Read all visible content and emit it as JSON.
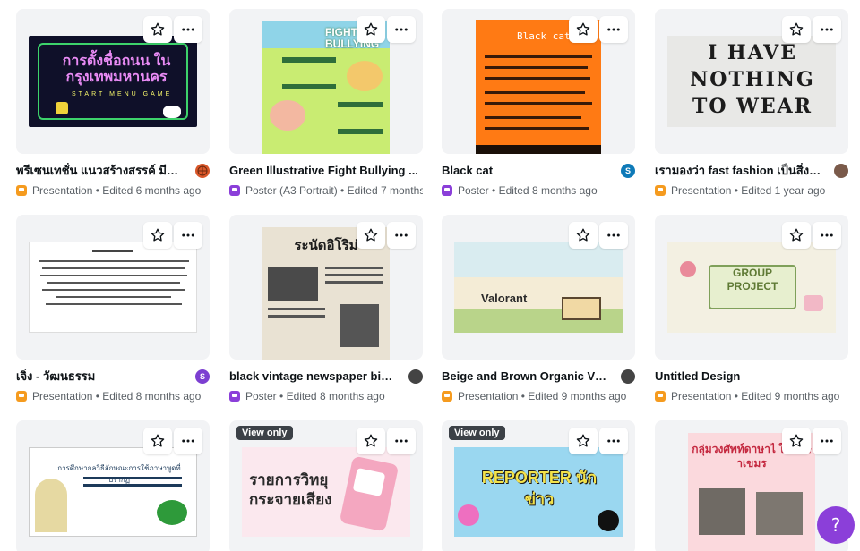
{
  "designs": [
    {
      "title": "พรีเซนเทชั่น แนวสร้างสรรค์ มีภาพ...",
      "type": "Presentation",
      "edited": "Edited 6 months ago",
      "owner": "avatar-basketball",
      "owner_color": "#d9572a",
      "thumb_text": "การตั้งชื่อถนน ในกรุงเทพมหานคร",
      "thumb_sub": "START MENU GAME"
    },
    {
      "title": "Green Illustrative Fight Bullying ...",
      "type": "Poster (A3 Portrait)",
      "edited": "Edited 7 months ago",
      "thumb_text": "FIGHT BULLYING"
    },
    {
      "title": "Black cat",
      "type": "Poster",
      "edited": "Edited 8 months ago",
      "owner_letter": "S",
      "owner_color": "#0e7ab8",
      "thumb_text": "Black cat"
    },
    {
      "title": "เรามองว่า fast fashion เป็นสิ่งที่อ...",
      "type": "Presentation",
      "edited": "Edited 1 year ago",
      "owner": "avatar-photo",
      "owner_color": "#7a5a4a",
      "thumb_text": "I HAVE NOTHING TO WEAR"
    },
    {
      "title": "เจิ่ง - วัฒนธรรม",
      "type": "Presentation",
      "edited": "Edited 8 months ago",
      "owner_letter": "S",
      "owner_color": "#7c3fd1"
    },
    {
      "title": "black vintage newspaper birt...",
      "type": "Poster",
      "edited": "Edited 8 months ago",
      "owner": "avatar-cartoon",
      "owner_color": "#444444",
      "thumb_text": "ระนัดอิโริม่"
    },
    {
      "title": "Beige and Brown Organic Vint...",
      "type": "Presentation",
      "edited": "Edited 9 months ago",
      "owner": "avatar-cartoon",
      "owner_color": "#444444",
      "thumb_text": "Valorant"
    },
    {
      "title": "Untitled Design",
      "type": "Presentation",
      "edited": "Edited 9 months ago",
      "thumb_text": "GROUP PROJECT"
    },
    {
      "title": "",
      "type": "",
      "edited": "",
      "thumb_text": "การศึกษากลวิธีลักษณะการใช้ภาษาพูดที่ปรากฏ"
    },
    {
      "title": "",
      "type": "",
      "edited": "",
      "badge": "View only",
      "thumb_text": "รายการวิทยุ กระจายเสียง"
    },
    {
      "title": "",
      "type": "",
      "edited": "",
      "badge": "View only",
      "thumb_text": "REPORTER นักข่าว"
    },
    {
      "title": "",
      "type": "",
      "edited": "",
      "thumb_text": "กลุ่มวงศัพท์ดาษาไ ในดาษาเขมร"
    }
  ],
  "help_label": "?",
  "meta_separator": "•"
}
